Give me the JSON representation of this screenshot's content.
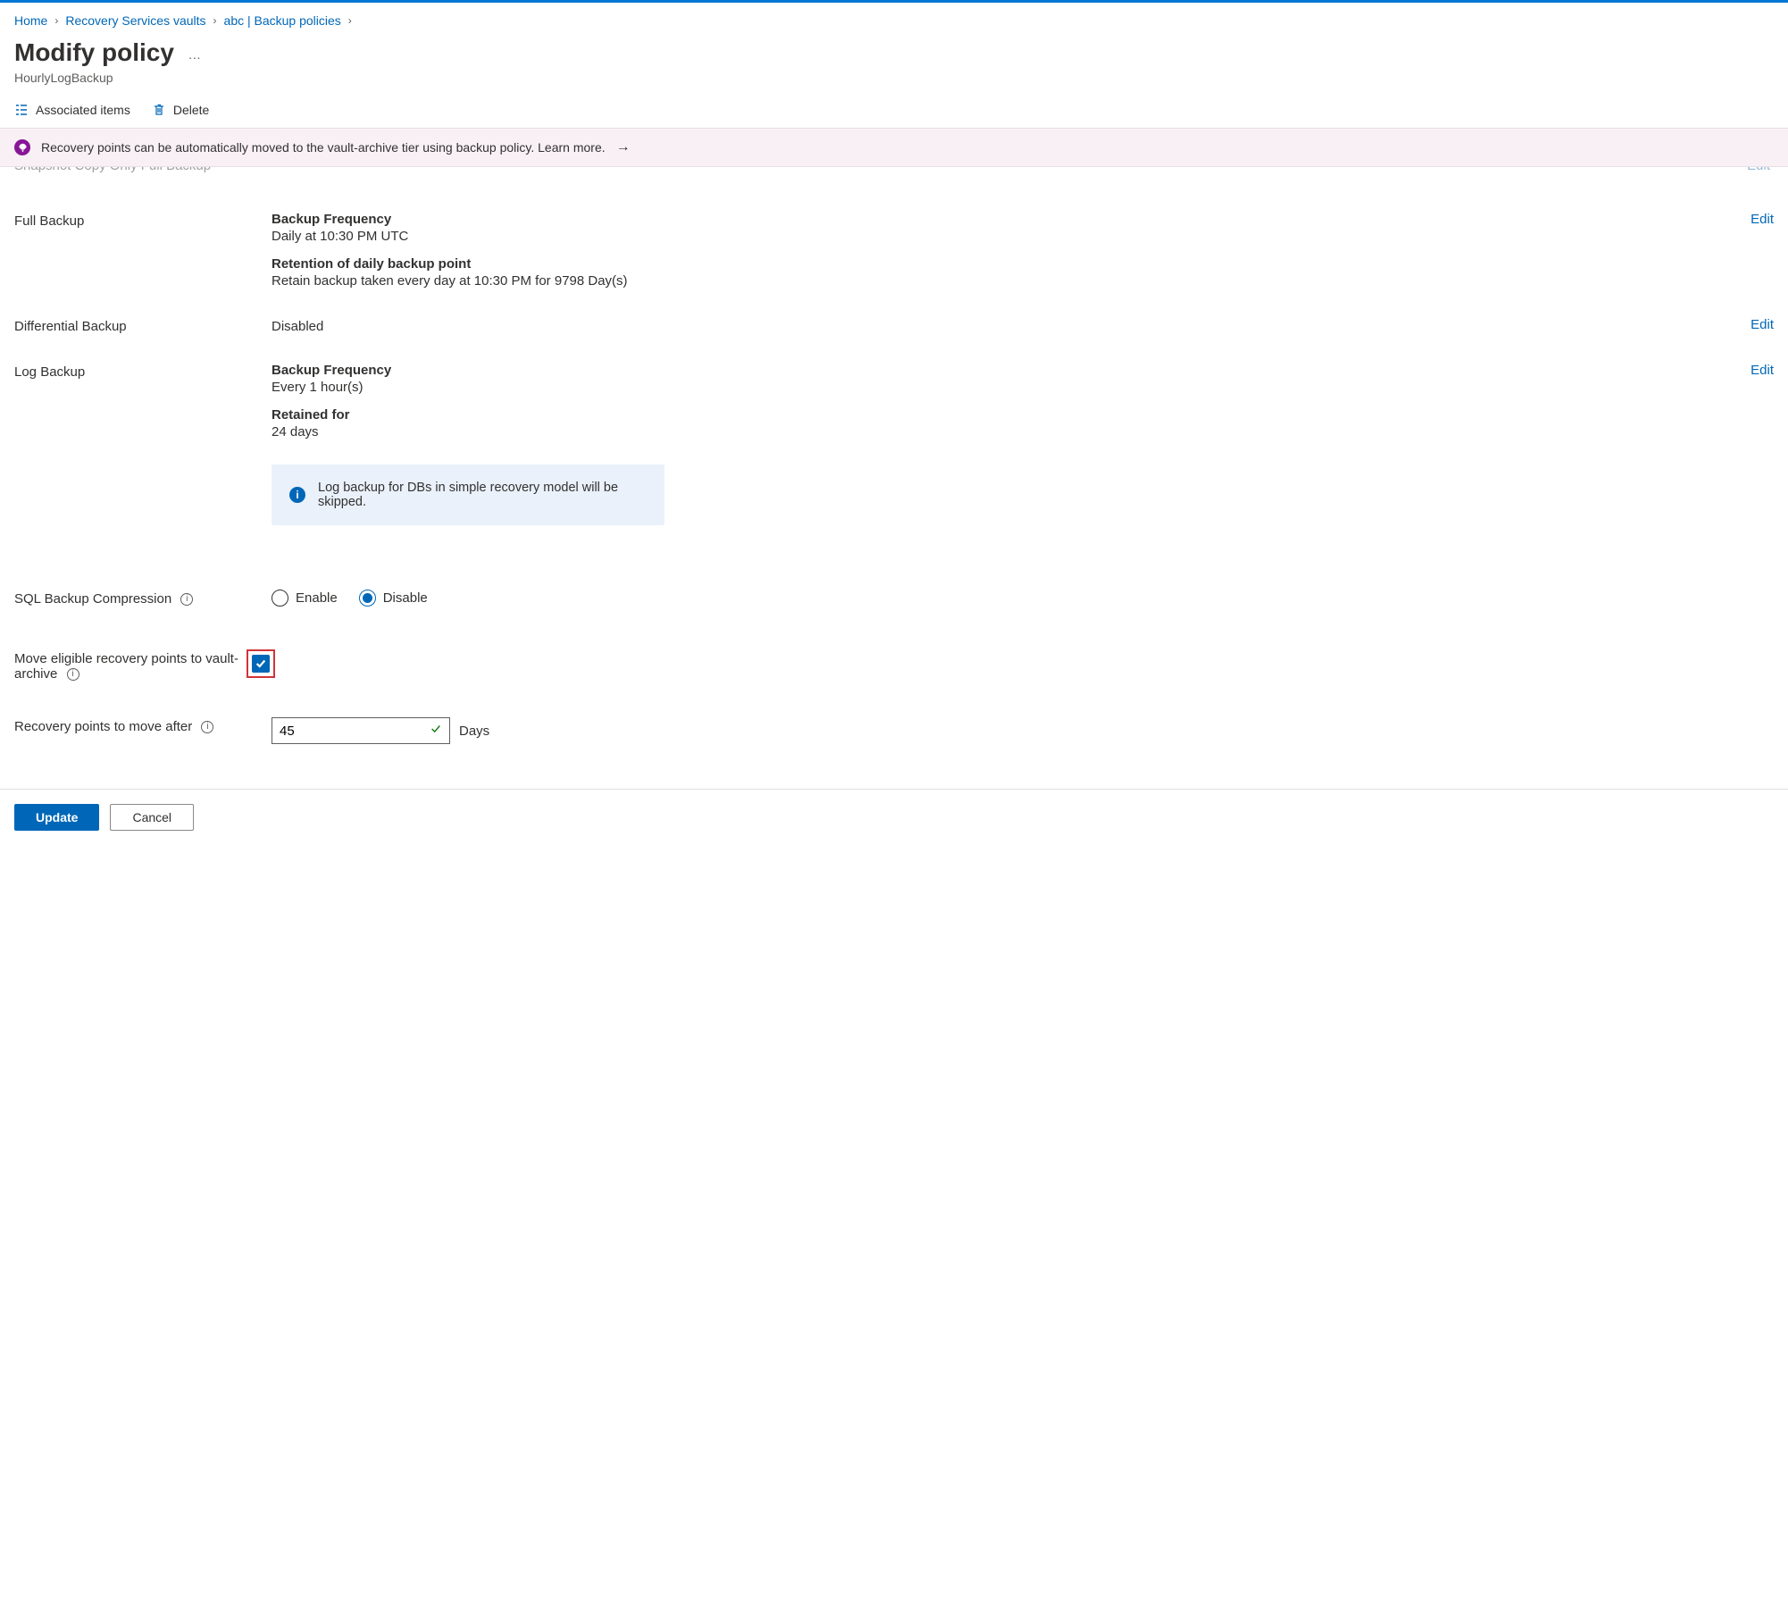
{
  "breadcrumb": {
    "home": "Home",
    "vaults": "Recovery Services vaults",
    "abc": "abc | Backup policies"
  },
  "header": {
    "title": "Modify policy",
    "subtitle": "HourlyLogBackup"
  },
  "commands": {
    "associated": "Associated items",
    "delete": "Delete"
  },
  "banner": {
    "text": "Recovery points can be automatically moved to the vault-archive tier using backup policy. Learn more."
  },
  "truncated": {
    "label": "Snapshot Copy Only Full Backup",
    "edit": "Edit"
  },
  "full_backup": {
    "label": "Full Backup",
    "freq_label": "Backup Frequency",
    "freq_value": "Daily at 10:30 PM UTC",
    "ret_label": "Retention of daily backup point",
    "ret_value": "Retain backup taken every day at 10:30 PM for 9798 Day(s)",
    "edit": "Edit"
  },
  "diff_backup": {
    "label": "Differential Backup",
    "value": "Disabled",
    "edit": "Edit"
  },
  "log_backup": {
    "label": "Log Backup",
    "freq_label": "Backup Frequency",
    "freq_value": "Every 1 hour(s)",
    "ret_label": "Retained for",
    "ret_value": "24 days",
    "info": "Log backup for DBs in simple recovery model will be skipped.",
    "edit": "Edit"
  },
  "compression": {
    "label": "SQL Backup Compression",
    "enable": "Enable",
    "disable": "Disable"
  },
  "archive": {
    "label": "Move eligible recovery points to vault-archive"
  },
  "move_after": {
    "label": "Recovery points to move after",
    "value": "45",
    "unit": "Days"
  },
  "footer": {
    "update": "Update",
    "cancel": "Cancel"
  }
}
